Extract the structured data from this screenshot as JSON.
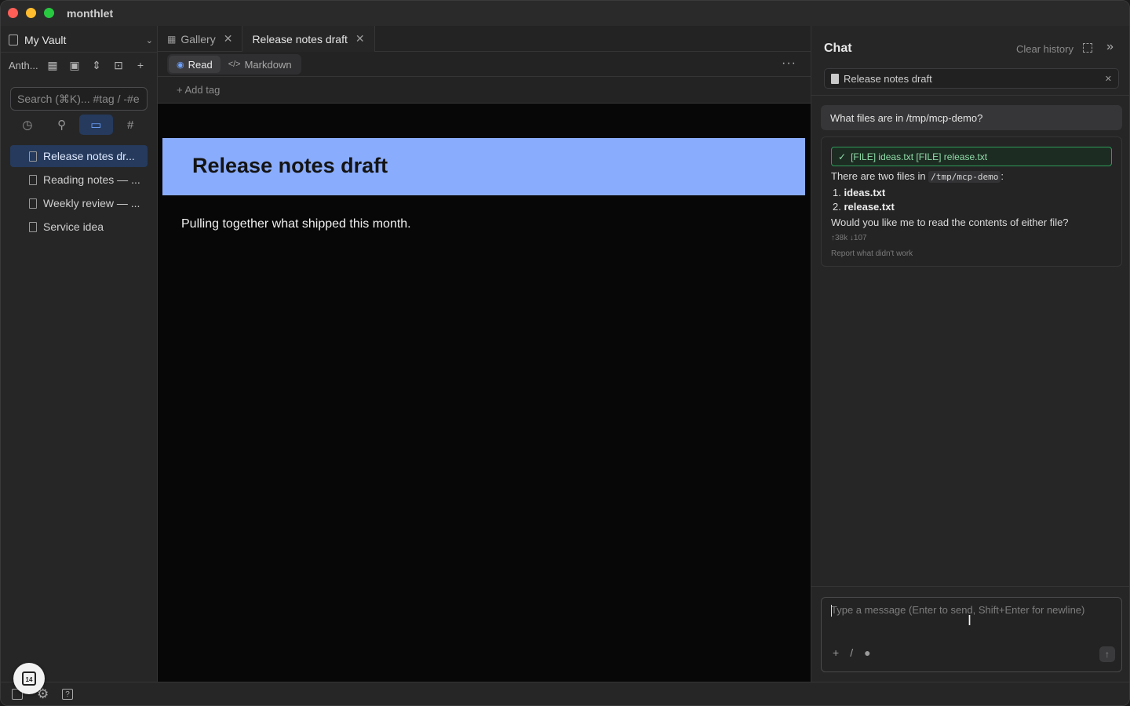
{
  "app": {
    "title": "monthlet"
  },
  "sidebar": {
    "vault_name": "My Vault",
    "workspace_label": "Anth...",
    "search_placeholder": "Search (⌘K)... #tag / -#e",
    "files": [
      {
        "label": "Release notes dr...",
        "active": true
      },
      {
        "label": "Reading notes — ...",
        "active": false
      },
      {
        "label": "Weekly review — ...",
        "active": false
      },
      {
        "label": "Service idea",
        "active": false
      }
    ]
  },
  "editor": {
    "tabs": [
      {
        "label": "Gallery",
        "active": false
      },
      {
        "label": "Release notes draft",
        "active": true
      }
    ],
    "modes": {
      "read": "Read",
      "markdown": "Markdown"
    },
    "add_tag": "+ Add tag",
    "doc_title": "Release notes draft",
    "doc_body": "Pulling together what shipped this month."
  },
  "chat": {
    "title": "Chat",
    "clear_history": "Clear history",
    "context_chip": "Release notes draft",
    "user_message": "What files are in /tmp/mcp-demo?",
    "tool_result": "[FILE] ideas.txt [FILE] release.txt",
    "reply_intro": "There are two files in",
    "reply_path": "/tmp/mcp-demo",
    "reply_colon": ":",
    "reply_item1_num": "1.",
    "reply_item1": "ideas.txt",
    "reply_item2_num": "2.",
    "reply_item2": "release.txt",
    "reply_question": "Would you like me to read the contents of either file?",
    "token_stats": "↑38k ↓107",
    "report_link": "Report what didn't work",
    "input_placeholder": "Type a message (Enter to send, Shift+Enter for newline)"
  },
  "calendar_day": "14",
  "colors": {
    "accent": "#6ea3ff",
    "banner": "#8aacfc",
    "tool_success": "#2e9a58"
  }
}
